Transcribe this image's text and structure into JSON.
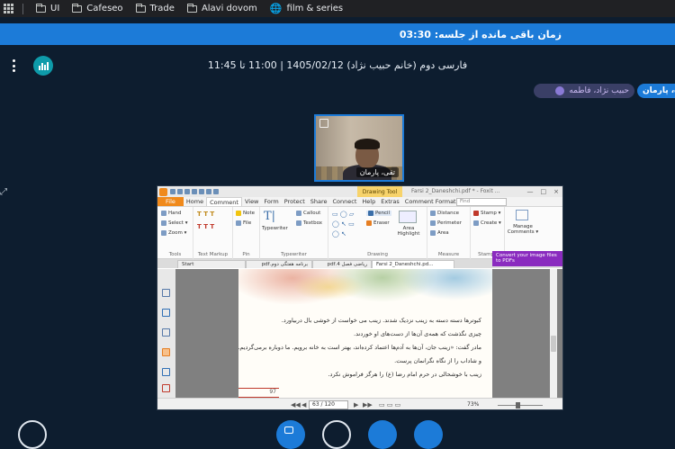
{
  "bookmarks": {
    "items": [
      {
        "label": "UI",
        "icon": "folder-icon"
      },
      {
        "label": "Cafeseo",
        "icon": "folder-icon"
      },
      {
        "label": "Trade",
        "icon": "folder-icon"
      },
      {
        "label": "Alavi dovom",
        "icon": "folder-icon"
      },
      {
        "label": "film & series",
        "icon": "globe-icon"
      }
    ]
  },
  "session": {
    "timer_text": "زمان باقی مانده از جلسه: 03:30",
    "title": "فارسی دوم (خانم حبیب نژاد) 1405/02/12 | 11:00 تا 11:45"
  },
  "participants": [
    {
      "label": "حبیب نژاد، فاطمه",
      "color": "#3a3f66"
    },
    {
      "label": "ه، پارمان",
      "color": "#1c7bd8"
    }
  ],
  "webcam": {
    "name_label": "تقی، پارمان"
  },
  "foxit": {
    "drawing_tools_label": "Drawing Tool",
    "doc_title": "Farsi 2_Daneshchi.pdf * - Foxit ...",
    "window_controls": [
      "—",
      "□",
      "×"
    ],
    "tabs": [
      "File",
      "Home",
      "Comment",
      "View",
      "Form",
      "Protect",
      "Share",
      "Connect",
      "Help",
      "Extras",
      "Comment Format"
    ],
    "active_tab": "Comment",
    "find_placeholder": "Find",
    "ribbon": {
      "tools": {
        "label": "Tools",
        "items": [
          "Hand",
          "Select ▾",
          "Zoom ▾"
        ]
      },
      "text_markup": {
        "label": "Text Markup"
      },
      "pin": {
        "label": "Pin",
        "items": [
          "Note",
          "File"
        ]
      },
      "typewriter": {
        "label": "Typewriter",
        "main": "Typewriter",
        "items": [
          "Callout",
          "Textbox"
        ]
      },
      "drawing": {
        "label": "Drawing",
        "items": [
          "Pencil",
          "Eraser"
        ],
        "area_highlight": "Area Highlight"
      },
      "measure": {
        "label": "Measure",
        "items": [
          "Distance",
          "Perimeter",
          "Area"
        ]
      },
      "stamps": {
        "label": "Stamps",
        "items": [
          "Stamp ▾",
          "Create ▾"
        ]
      },
      "manage": {
        "label": "Manage Comments ▾"
      }
    },
    "doc_tabs": [
      "Start",
      "برنامه هفتگی دوم.pdf",
      "ریاضی فصل 4.pdf",
      "Farsi 2_Daneshchi.pd..."
    ],
    "convert_ad": "Convert your image files to PDFs",
    "page_lines": [
      "کبوترها دسته دسته به زینب نزدیک شدند. زینب می خواست از خوشی بال دربیاورد.",
      "چیزی نگذشت که همه‌ی آن‌ها از دست‌های او خوردند.",
      "مادر گفت: «زینب جان، آن‌ها به آدم‌ها اعتماد کرده‌اند، بهتر است به خانه برویم. ما دوباره برمی‌گردیم.»",
      "و شاداب را از نگاه نگرانمان پرست.",
      "زینب با خوشحالی در حرم امام رضا (ع) را هرگز فراموش نکرد."
    ],
    "page_number_mark": "97",
    "status": {
      "page_indicator": "63 / 120",
      "zoom": "73%"
    }
  },
  "colors": {
    "background": "#0d1d2f",
    "accent": "#1c7bd8",
    "stats_button": "#0e9baa",
    "foxit_orange": "#f08a1c",
    "ad_purple": "#8a2bbf"
  }
}
